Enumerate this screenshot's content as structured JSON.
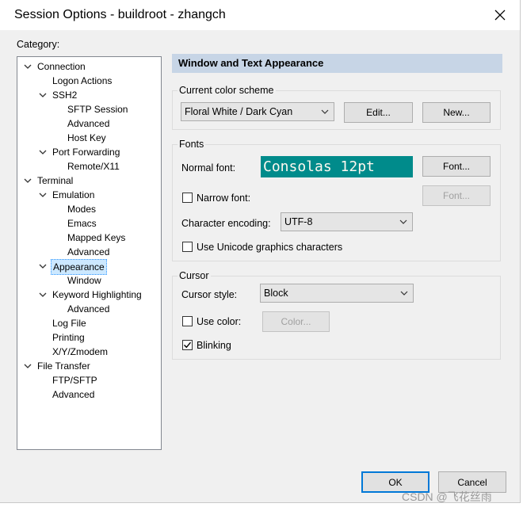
{
  "window": {
    "title": "Session Options - buildroot - zhangch"
  },
  "category": {
    "label": "Category:",
    "nodes": [
      {
        "label": "Connection",
        "level": 0,
        "expanded": true
      },
      {
        "label": "Logon Actions",
        "level": 1
      },
      {
        "label": "SSH2",
        "level": 1,
        "expanded": true
      },
      {
        "label": "SFTP Session",
        "level": 2
      },
      {
        "label": "Advanced",
        "level": 2
      },
      {
        "label": "Host Key",
        "level": 2
      },
      {
        "label": "Port Forwarding",
        "level": 1,
        "expanded": true
      },
      {
        "label": "Remote/X11",
        "level": 2
      },
      {
        "label": "Terminal",
        "level": 0,
        "expanded": true
      },
      {
        "label": "Emulation",
        "level": 1,
        "expanded": true
      },
      {
        "label": "Modes",
        "level": 2
      },
      {
        "label": "Emacs",
        "level": 2
      },
      {
        "label": "Mapped Keys",
        "level": 2
      },
      {
        "label": "Advanced",
        "level": 2
      },
      {
        "label": "Appearance",
        "level": 1,
        "expanded": true,
        "selected": true
      },
      {
        "label": "Window",
        "level": 2
      },
      {
        "label": "Keyword Highlighting",
        "level": 1,
        "expanded": true
      },
      {
        "label": "Advanced",
        "level": 2
      },
      {
        "label": "Log File",
        "level": 1
      },
      {
        "label": "Printing",
        "level": 1
      },
      {
        "label": "X/Y/Zmodem",
        "level": 1
      },
      {
        "label": "File Transfer",
        "level": 0,
        "expanded": true
      },
      {
        "label": "FTP/SFTP",
        "level": 1
      },
      {
        "label": "Advanced",
        "level": 1
      }
    ]
  },
  "panel": {
    "header": "Window and Text Appearance",
    "color_scheme": {
      "group_label": "Current color scheme",
      "selected": "Floral White / Dark Cyan",
      "edit_button": "Edit...",
      "new_button": "New..."
    },
    "fonts": {
      "group_label": "Fonts",
      "normal_font_label": "Normal font:",
      "preview": "Consolas 12pt",
      "font_button": "Font...",
      "narrow_font_label": "Narrow font:",
      "narrow_font_checked": false,
      "narrow_font_button": "Font...",
      "encoding_label": "Character encoding:",
      "encoding_value": "UTF-8",
      "unicode_label": "Use Unicode graphics characters",
      "unicode_checked": false
    },
    "cursor": {
      "group_label": "Cursor",
      "style_label": "Cursor style:",
      "style_value": "Block",
      "use_color_label": "Use color:",
      "use_color_checked": false,
      "color_button": "Color...",
      "blinking_label": "Blinking",
      "blinking_checked": true
    }
  },
  "footer": {
    "ok_button": "OK",
    "cancel_button": "Cancel"
  },
  "watermark": "CSDN @飞花丝雨",
  "colors": {
    "preview_background": "#008b8b",
    "preview_text": "#fffaf0",
    "header_background": "#c7d5e6",
    "selection": "#cce8ff"
  }
}
